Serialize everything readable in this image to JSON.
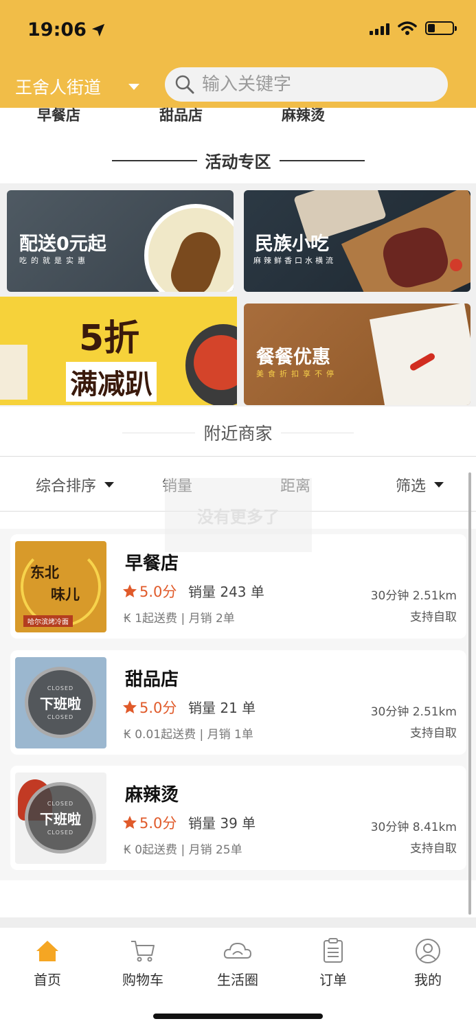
{
  "status_bar": {
    "time": "19:06"
  },
  "header": {
    "location": "王舍人街道",
    "search_placeholder": "输入关键字",
    "brand_color": "#f1bd48"
  },
  "categories": [
    "早餐店",
    "甜品店",
    "麻辣烫"
  ],
  "activity_section": {
    "title": "活动专区",
    "banners": [
      {
        "main": "配送0元起",
        "sub": "吃的就是实惠"
      },
      {
        "main": "民族小吃",
        "sub": "麻辣鲜香口水横流"
      },
      {
        "main_top": "5折",
        "main_bottom": "满减趴"
      },
      {
        "main": "餐餐优惠",
        "sub": "美食折扣享不停"
      }
    ]
  },
  "nearby_section": {
    "title": "附近商家"
  },
  "sort_bar": {
    "comprehensive": "综合排序",
    "sales": "销量",
    "distance": "距离",
    "filter": "筛选"
  },
  "toast": "没有更多了",
  "shops": [
    {
      "name": "早餐店",
      "rating": "5.0分",
      "sales": "销量 243 单",
      "fee": "₭ 1起送费 | 月销 2单",
      "eta_distance": "30分钟  2.51km",
      "pickup": "支持自取",
      "logo_text_1": "东北",
      "logo_text_2": "味儿",
      "logo_caption": "哈尔滨烤冷面"
    },
    {
      "name": "甜品店",
      "rating": "5.0分",
      "sales": "销量 21 单",
      "fee": "₭ 0.01起送费 | 月销 1单",
      "eta_distance": "30分钟  2.51km",
      "pickup": "支持自取",
      "badge_closed": "CLOSED",
      "badge_main": "下班啦"
    },
    {
      "name": "麻辣烫",
      "rating": "5.0分",
      "sales": "销量 39 单",
      "fee": "₭ 0起送费 | 月销 25单",
      "eta_distance": "30分钟  8.41km",
      "pickup": "支持自取",
      "badge_closed": "CLOSED",
      "badge_main": "下班啦"
    }
  ],
  "tabs": [
    {
      "label": "首页",
      "icon": "home-icon",
      "active": true
    },
    {
      "label": "购物车",
      "icon": "cart-icon"
    },
    {
      "label": "生活圈",
      "icon": "life-circle-icon"
    },
    {
      "label": "订单",
      "icon": "orders-icon"
    },
    {
      "label": "我的",
      "icon": "profile-icon"
    }
  ],
  "colors": {
    "accent": "#f1bd48",
    "rating": "#e05a2a"
  }
}
